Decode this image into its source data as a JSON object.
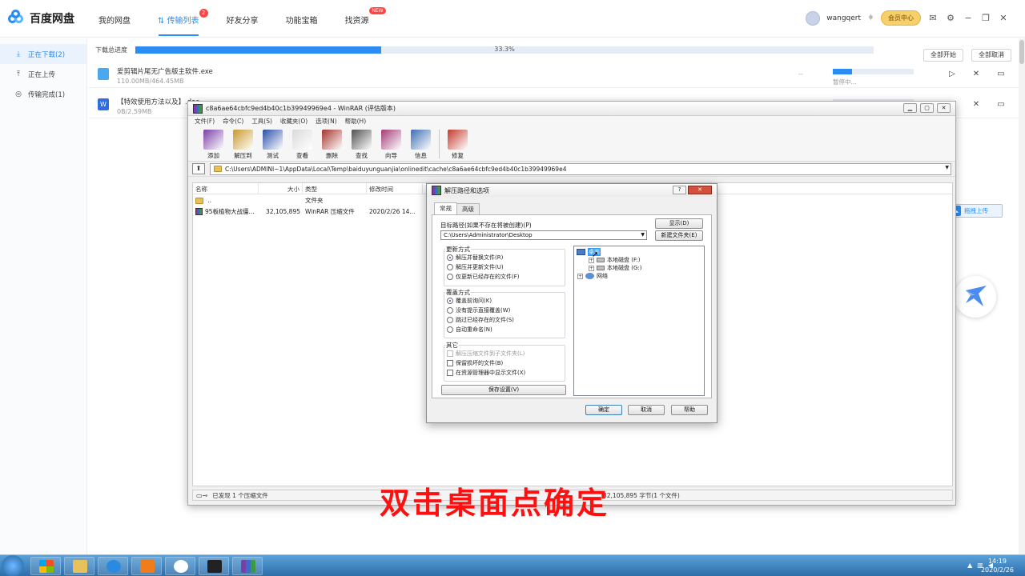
{
  "app": {
    "name": "百度网盘"
  },
  "top_nav": [
    {
      "label": "我的网盘"
    },
    {
      "label": "传输列表",
      "badge": "2"
    },
    {
      "label": "好友分享"
    },
    {
      "label": "功能宝箱"
    },
    {
      "label": "找资源",
      "badge": "NEW"
    }
  ],
  "user": {
    "name": "wangqert",
    "vip_label": "会员中心"
  },
  "sidebar": [
    {
      "label": "正在下载(2)",
      "icon": "download-icon"
    },
    {
      "label": "正在上传",
      "icon": "upload-icon"
    },
    {
      "label": "传输完成(1)",
      "icon": "check-icon"
    }
  ],
  "downloads": {
    "total_label": "下载总进度",
    "total_percent_text": "33.3%",
    "total_progress": 0.333,
    "start_all": "全部开始",
    "cancel_all": "全部取消",
    "items": [
      {
        "name": "爱剪辑片尾无广告版主软件.exe",
        "size": "110.00MB/464.45MB",
        "speed": "--",
        "state": "暂停中...",
        "progress": 0.24
      },
      {
        "name": "【特效使用方法以及】.doc",
        "size": "0B/2.59MB",
        "speed": "--",
        "state": "",
        "progress": 0.0
      }
    ]
  },
  "float_upload": "拖拽上传",
  "winrar": {
    "title": "c8a6ae64cbfc9ed4b40c1b39949969e4 - WinRAR (评估版本)",
    "menu": [
      "文件(F)",
      "命令(C)",
      "工具(S)",
      "收藏夹(O)",
      "选项(N)",
      "帮助(H)"
    ],
    "toolbar": [
      {
        "label": "添加",
        "color": "#7b3fa8"
      },
      {
        "label": "解压到",
        "color": "#c89a2c"
      },
      {
        "label": "测试",
        "color": "#2b4fa8"
      },
      {
        "label": "查看",
        "color": "#d9d9d9"
      },
      {
        "label": "删除",
        "color": "#a6332a"
      },
      {
        "label": "查找",
        "color": "#505050"
      },
      {
        "label": "向导",
        "color": "#a33b76"
      },
      {
        "label": "信息",
        "color": "#3f6db5"
      },
      {
        "label": "修复",
        "color": "#c43a2e"
      }
    ],
    "path": "C:\\Users\\ADMINI~1\\AppData\\Local\\Temp\\baiduyunguanjia\\onlinedit\\cache\\c8a6ae64cbfc9ed4b40c1b39949969e4",
    "columns": [
      "名称",
      "大小",
      "类型",
      "修改时间"
    ],
    "rows": [
      {
        "name": "..",
        "size": "",
        "type": "文件夹",
        "time": ""
      },
      {
        "name": "95板植物大战僵...",
        "size": "32,105,895",
        "type": "WinRAR 压缩文件",
        "time": "2020/2/26 14..."
      }
    ],
    "status_left": "已发现 1 个压缩文件",
    "status_right": "32,105,895 字节(1 个文件)"
  },
  "dialog": {
    "title": "解压路径和选项",
    "tabs": [
      "常规",
      "高级"
    ],
    "target_label": "目标路径(如果不存在将被创建)(P)",
    "target_value": "C:\\Users\\Administrator\\Desktop",
    "show_btn": "显示(D)",
    "new_folder_btn": "新建文件夹(E)",
    "update_title": "更新方式",
    "update_options": [
      "解压并替换文件(R)",
      "解压并更新文件(U)",
      "仅更新已经存在的文件(F)"
    ],
    "overwrite_title": "覆盖方式",
    "overwrite_options": [
      "覆盖前询问(K)",
      "没有提示直接覆盖(W)",
      "跳过已经存在的文件(S)",
      "自动重命名(N)"
    ],
    "other_title": "其它",
    "other_options": [
      "解压压缩文件到子文件夹(L)",
      "保留损坏的文件(B)",
      "在资源管理器中显示文件(X)"
    ],
    "save_btn": "保存设置(V)",
    "tree": [
      "桌面",
      "本地磁盘 (F:)",
      "本地磁盘 (G:)",
      "网络"
    ],
    "ok": "确定",
    "cancel": "取消",
    "help": "帮助"
  },
  "overlay_text": "双击桌面点确定",
  "taskbar": {
    "time": "14:19",
    "date": "2020/2/26"
  }
}
